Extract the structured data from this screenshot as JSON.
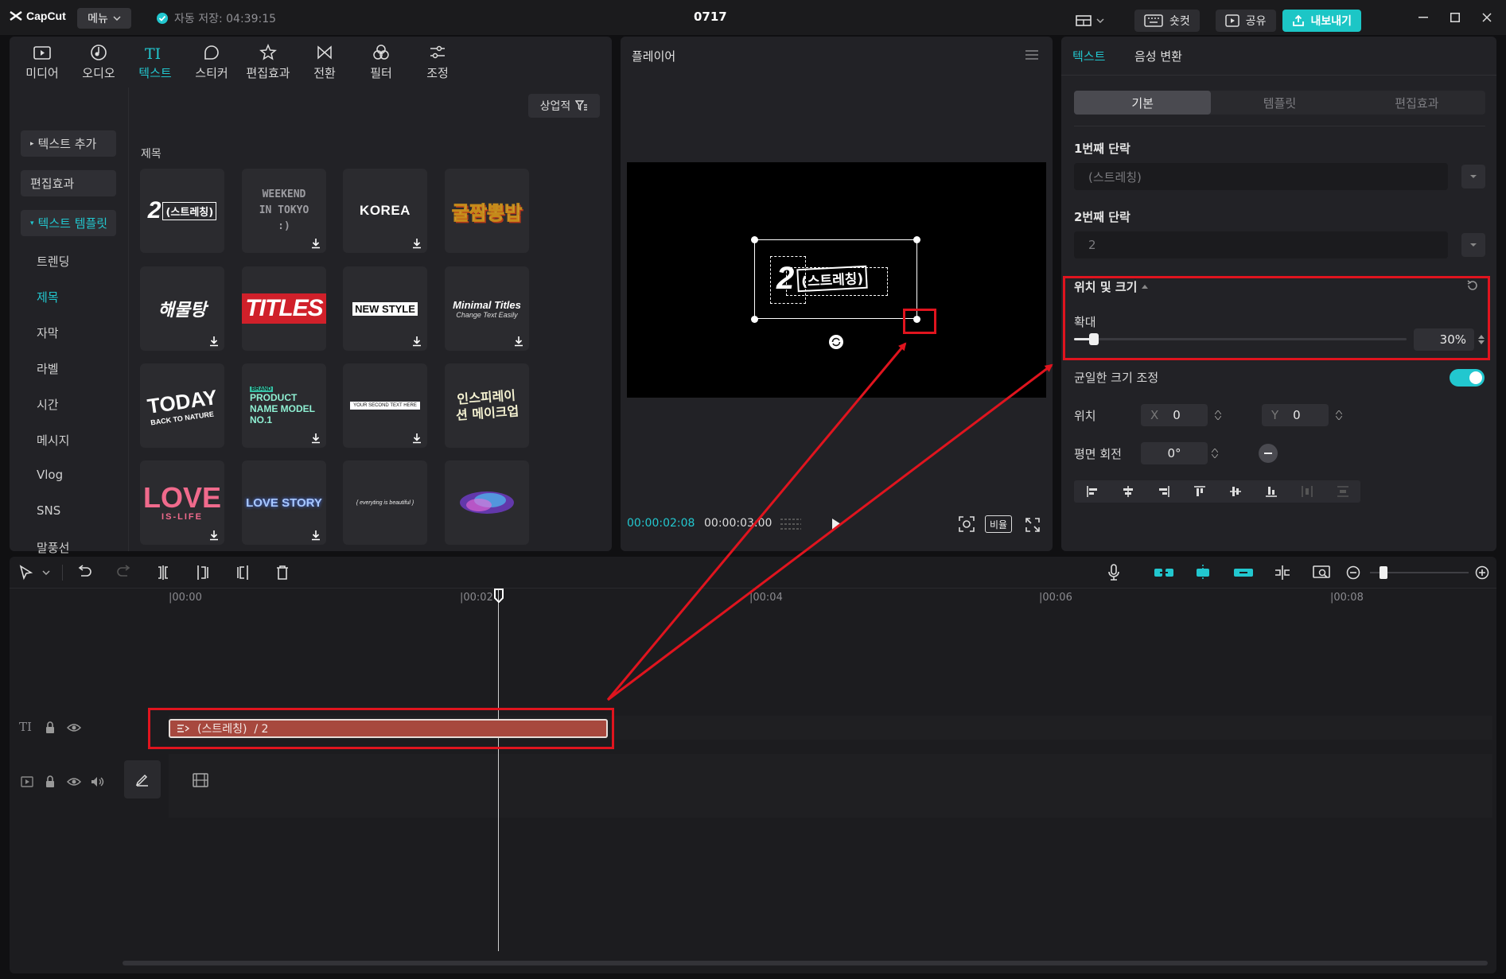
{
  "titlebar": {
    "app_name": "CapCut",
    "menu_label": "메뉴",
    "autosave_text": "자동 저장: 04:39:15",
    "project_title": "0717",
    "shortcut_label": "숏컷",
    "share_label": "공유",
    "export_label": "내보내기"
  },
  "media_tabs": [
    {
      "label": "미디어",
      "icon": "media-icon"
    },
    {
      "label": "오디오",
      "icon": "audio-icon"
    },
    {
      "label": "텍스트",
      "icon": "text-icon",
      "active": true
    },
    {
      "label": "스티커",
      "icon": "sticker-icon"
    },
    {
      "label": "편집효과",
      "icon": "effects-icon"
    },
    {
      "label": "전환",
      "icon": "transition-icon"
    },
    {
      "label": "필터",
      "icon": "filter-icon"
    },
    {
      "label": "조정",
      "icon": "adjust-icon"
    }
  ],
  "sidebar": {
    "add_text": "텍스트 추가",
    "effects": "편집효과",
    "templates": "텍스트 템플릿",
    "sub_items": [
      "트렌딩",
      "제목",
      "자막",
      "라벨",
      "시간",
      "메시지",
      "Vlog",
      "SNS",
      "말풍선",
      "음식"
    ]
  },
  "library": {
    "filter_label": "상업적",
    "section_title": "제목",
    "tiles": [
      {
        "text": "2(스트레칭)"
      },
      {
        "text": "WEEKEND IN TOKYO :)"
      },
      {
        "text": "KOREA"
      },
      {
        "text": "굴짬뽕밥"
      },
      {
        "text": "해물탕"
      },
      {
        "text": "TITLES"
      },
      {
        "text": "NEW STYLE"
      },
      {
        "text": "Minimal Titles"
      },
      {
        "text": "TODAY"
      },
      {
        "text": "PRODUCT NAME MODEL NO.1"
      },
      {
        "text": "YOUR SECOND TEXT HERE"
      },
      {
        "text": "인스피레이션 메이크업"
      },
      {
        "text": "LOVE"
      },
      {
        "text": "LOVE STORY"
      },
      {
        "text": "{ everyting is beautiful }"
      },
      {
        "text": ""
      }
    ],
    "tile_subtexts": {
      "product_tag": "BRAND",
      "minimal_sub": "Change Text Easily",
      "today_sub": "BACK TO NATURE",
      "love_sub": "IS-LIFE"
    }
  },
  "player": {
    "title": "플레이어",
    "canvas_number": "2",
    "canvas_text": "(스트레칭)",
    "current_time": "00:00:02:08",
    "total_time": "00:00:03:00",
    "ratio_label": "비율"
  },
  "right_panel": {
    "tabs": [
      "텍스트",
      "음성 변환"
    ],
    "segments": [
      "기본",
      "템플릿",
      "편집효과"
    ],
    "para1_label": "1번째 단락",
    "para1_value": "(스트레칭)",
    "para2_label": "2번째 단락",
    "para2_value": "2",
    "pos_size_label": "위치 및 크기",
    "scale_label": "확대",
    "scale_value": "30%",
    "uniform_label": "균일한 크기 조정",
    "position_label": "위치",
    "x_label": "X",
    "x_value": "0",
    "y_label": "Y",
    "y_value": "0",
    "rotation_label": "평면 회전",
    "rotation_value": "0°"
  },
  "scale_fraction": 0.06,
  "timeline": {
    "ruler": [
      "|00:00",
      "|00:02",
      "|00:04",
      "|00:06",
      "|00:08"
    ],
    "clip_label": "(스트레칭)  / 2",
    "track_text_icon": "TI"
  },
  "colors": {
    "accent": "#22c7cf",
    "clip": "#a7483e",
    "annotation": "#e0141e"
  }
}
